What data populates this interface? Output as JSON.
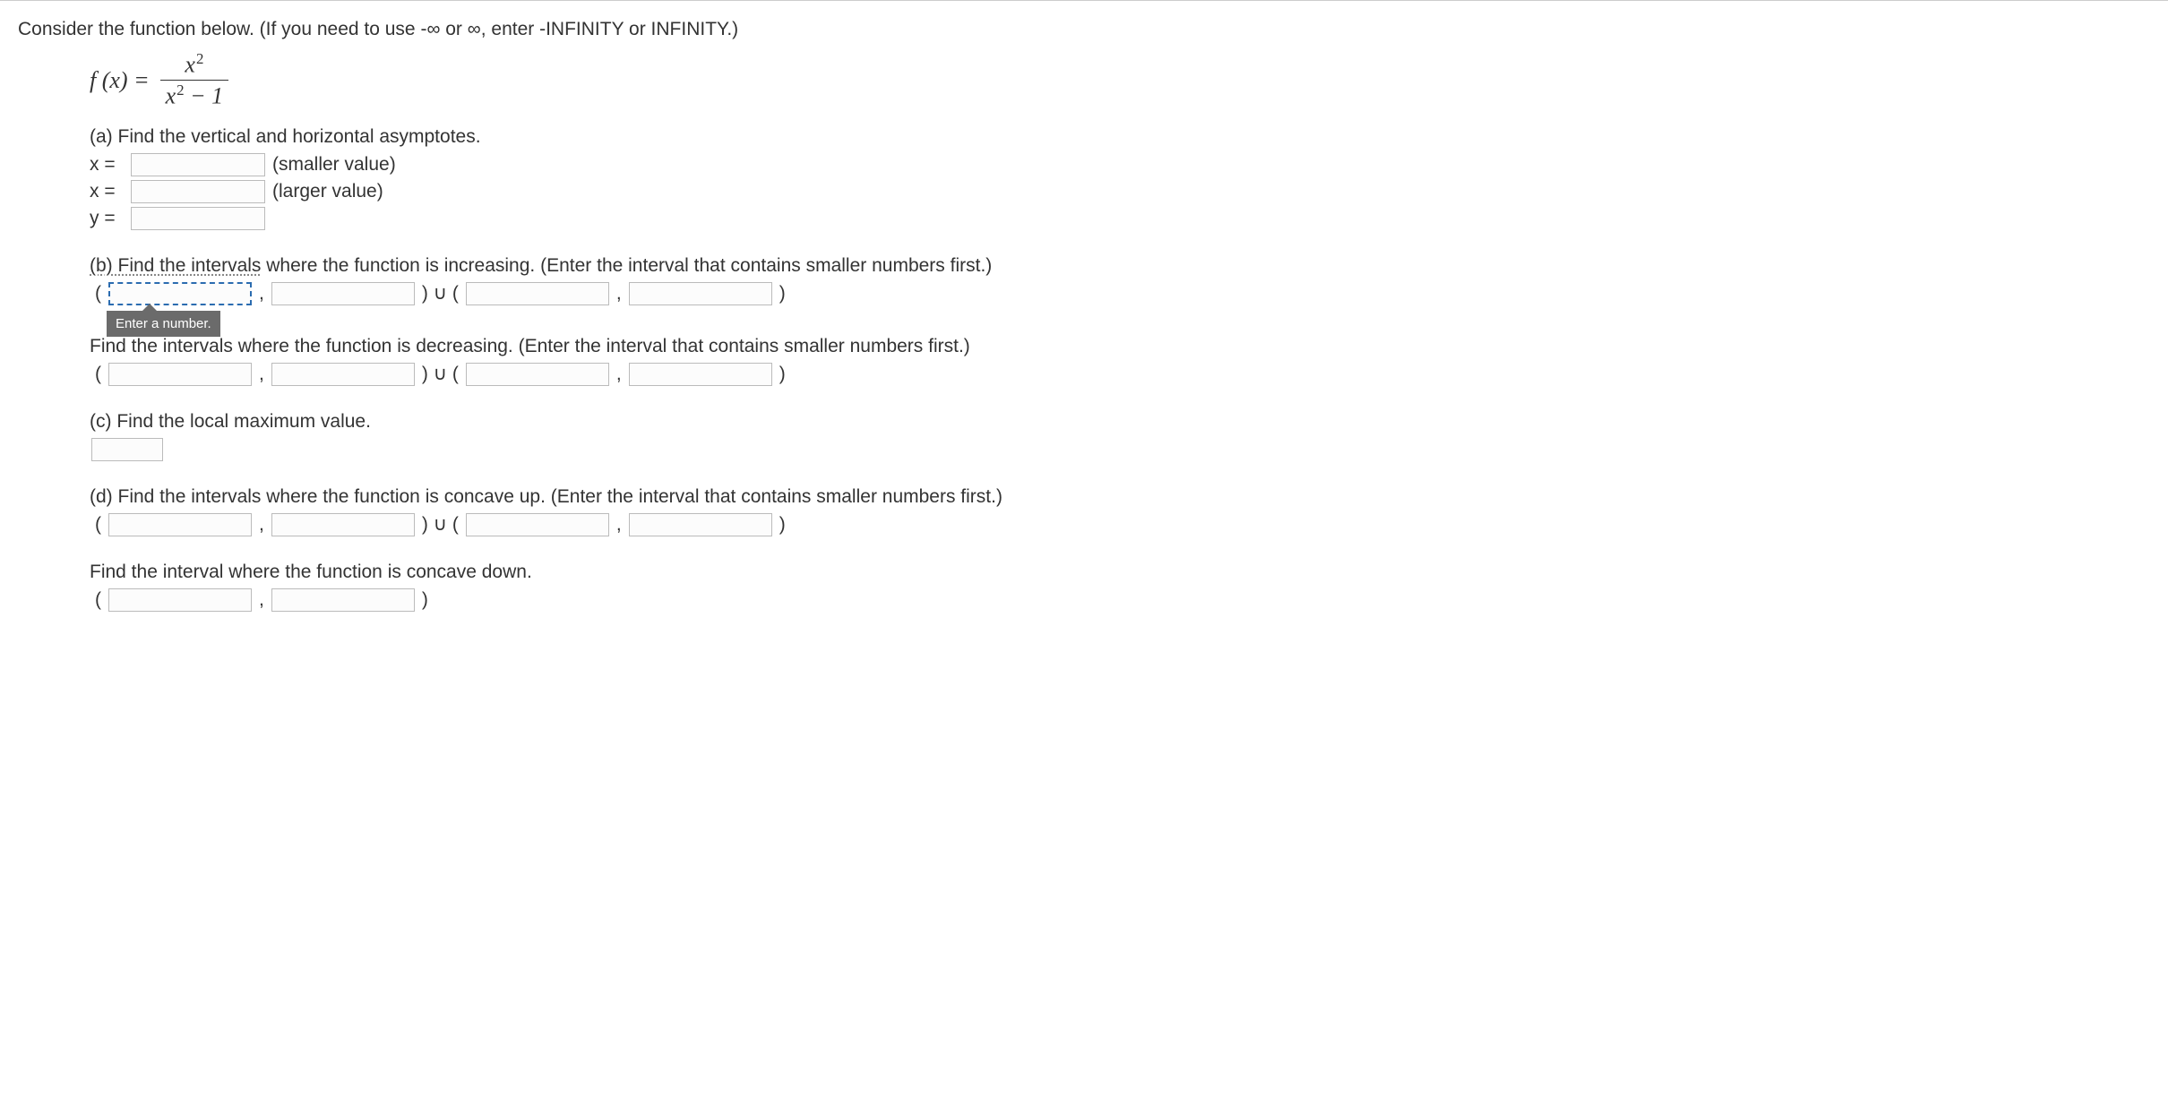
{
  "intro": "Consider the function below. (If you need to use -∞ or ∞, enter -INFINITY or INFINITY.)",
  "formula": {
    "lhs": "f (x) =",
    "num_base": "x",
    "num_exp": "2",
    "den_base": "x",
    "den_exp": "2",
    "den_tail": " − 1"
  },
  "a": {
    "prompt": "(a) Find the vertical and horizontal asymptotes.",
    "x_eq": "x =",
    "smaller": "(smaller value)",
    "larger": "(larger value)",
    "y_eq": "y ="
  },
  "b": {
    "prompt_inc_pre": "(b) Find the intervals",
    "prompt_inc_post": " where the function is increasing. (Enter the interval that contains smaller numbers first.)",
    "open": "(",
    "comma": ",",
    "close_union_open": ") ∪ (",
    "close": ")",
    "tooltip": "Enter a number.",
    "prompt_dec": "Find the intervals where the function is decreasing. (Enter the interval that contains smaller numbers first.)"
  },
  "c": {
    "prompt": "(c) Find the local maximum value."
  },
  "d": {
    "prompt_up": "(d) Find the intervals where the function is concave up. (Enter the interval that contains smaller numbers first.)",
    "open": "(",
    "comma": ",",
    "close_union_open": ") ∪ (",
    "close": ")",
    "prompt_down": "Find the interval where the function is concave down."
  }
}
